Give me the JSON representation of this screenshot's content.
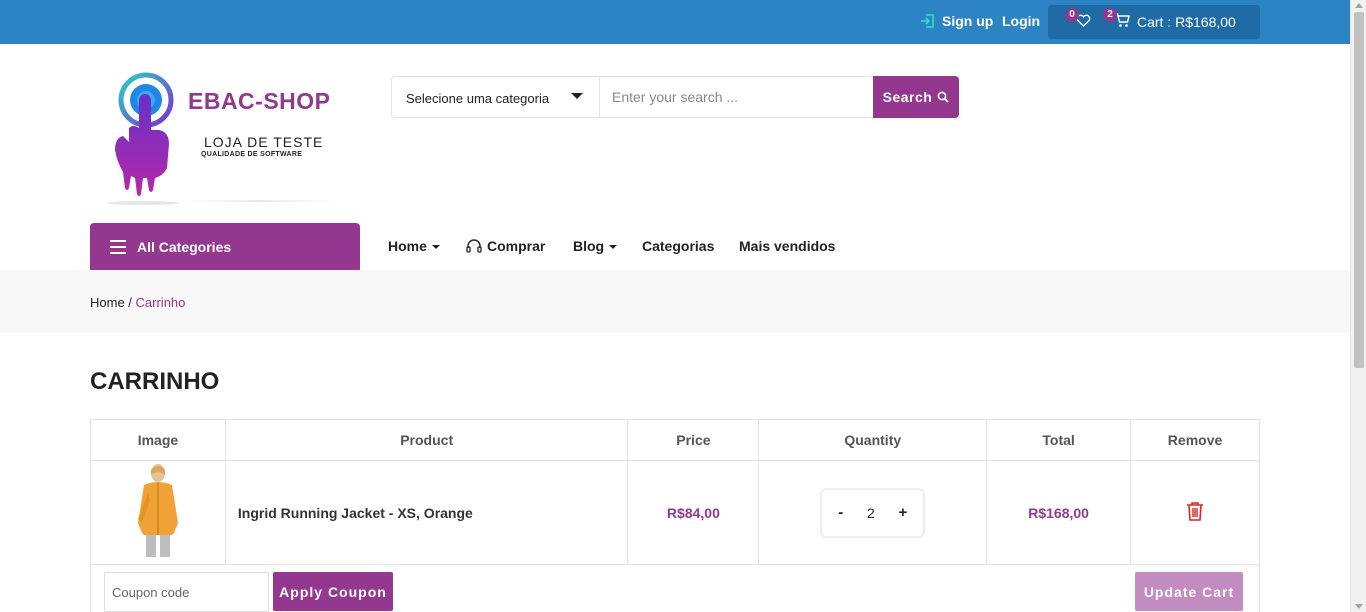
{
  "topbar": {
    "signup_label": "Sign up",
    "login_label": "Login",
    "wishlist_count": "0",
    "cart_count": "2",
    "cart_label": "Cart : R$168,00"
  },
  "brand": {
    "title": "EBAC-SHOP",
    "subtitle": "LOJA DE TESTE",
    "tagline": "QUALIDADE DE SOFTWARE"
  },
  "search": {
    "category_selected": "Selecione uma categoria",
    "placeholder": "Enter your search ...",
    "button_label": "Search"
  },
  "nav": {
    "all_categories": "All Categories",
    "items": [
      {
        "label": "Home"
      },
      {
        "label": "Comprar"
      },
      {
        "label": "Blog"
      },
      {
        "label": "Categorias"
      },
      {
        "label": "Mais vendidos"
      }
    ]
  },
  "breadcrumb": {
    "home": "Home",
    "separator": " / ",
    "current": "Carrinho"
  },
  "page_title": "CARRINHO",
  "table": {
    "headers": [
      "Image",
      "Product",
      "Price",
      "Quantity",
      "Total",
      "Remove"
    ],
    "rows": [
      {
        "product": "Ingrid Running Jacket - XS, Orange",
        "price": "R$84,00",
        "quantity": "2",
        "total": "R$168,00"
      }
    ],
    "minus_label": "-",
    "plus_label": "+"
  },
  "coupon": {
    "placeholder": "Coupon code",
    "apply_label": "Apply Coupon",
    "update_label": "Update Cart"
  },
  "colors": {
    "topbar": "#2d84c4",
    "accent": "#93378f",
    "remove": "#e02424"
  },
  "icons": [
    "signin-icon",
    "heart-icon",
    "cart-icon",
    "search-icon",
    "headset-icon",
    "trash-icon",
    "menu-icon"
  ]
}
